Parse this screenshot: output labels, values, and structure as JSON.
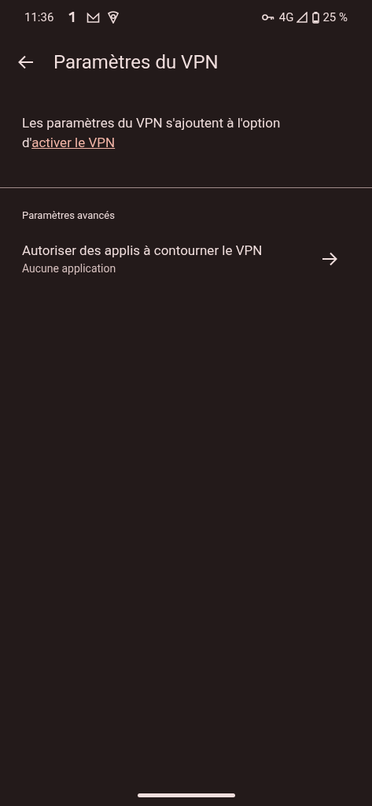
{
  "status_bar": {
    "time": "11:36",
    "network": "4G",
    "battery": "25 %"
  },
  "header": {
    "title": "Paramètres du VPN"
  },
  "description": {
    "text": "Les paramètres du VPN s'ajoutent à l'option d'",
    "link": "activer le VPN"
  },
  "section": {
    "title": "Paramètres avancés"
  },
  "items": [
    {
      "title": "Autoriser des applis à contourner le VPN",
      "subtitle": "Aucune application"
    }
  ]
}
